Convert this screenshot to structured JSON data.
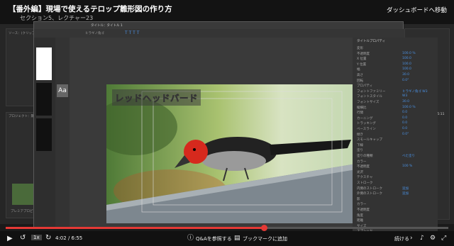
{
  "header": {
    "title": "【番外編】現場で使えるテロップ雛形図の作り方",
    "subtitle": "セクション5、レクチャー23",
    "dashboard_link": "ダッシュボードへ移動"
  },
  "titler": {
    "tab_title": "タイトル：タイトル 1",
    "font_name": "ヒラギノ角ゴ",
    "canvas_text": "レッドヘッドバード",
    "side_label": "Aa",
    "props_title": "タイトルプロパティ",
    "props": [
      {
        "name": "変形",
        "value": ""
      },
      {
        "name": "不透明度",
        "value": "100.0 %"
      },
      {
        "name": "X 位置",
        "value": "100.0"
      },
      {
        "name": "Y 位置",
        "value": "100.0"
      },
      {
        "name": "幅",
        "value": "100.0"
      },
      {
        "name": "高さ",
        "value": "30.0"
      },
      {
        "name": "回転",
        "value": "0.0°"
      },
      {
        "name": "プロパティ",
        "value": ""
      },
      {
        "name": "フォントファミリー",
        "value": "ヒラギノ角ゴ W3"
      },
      {
        "name": "フォントスタイル",
        "value": "W3"
      },
      {
        "name": "フォントサイズ",
        "value": "30.0"
      },
      {
        "name": "縦横比",
        "value": "100.0 %"
      },
      {
        "name": "行間",
        "value": "0.0"
      },
      {
        "name": "カーニング",
        "value": "0.0"
      },
      {
        "name": "トラッキング",
        "value": "0.0"
      },
      {
        "name": "ベースライン",
        "value": "0.0"
      },
      {
        "name": "傾き",
        "value": "0.0°"
      },
      {
        "name": "スモールキャップ",
        "value": ""
      },
      {
        "name": "下線",
        "value": ""
      },
      {
        "name": "塗り",
        "value": ""
      },
      {
        "name": "塗りの種類",
        "value": "べた塗り"
      },
      {
        "name": "カラー",
        "value": ""
      },
      {
        "name": "不透明度",
        "value": "100 %"
      },
      {
        "name": "光沢",
        "value": ""
      },
      {
        "name": "テクスチャ",
        "value": ""
      },
      {
        "name": "ストローク",
        "value": ""
      },
      {
        "name": "内側のストローク",
        "value": "追加"
      },
      {
        "name": "外側のストローク",
        "value": "追加"
      },
      {
        "name": "影",
        "value": ""
      },
      {
        "name": "カラー",
        "value": ""
      },
      {
        "name": "不透明度",
        "value": ""
      },
      {
        "name": "角度",
        "value": ""
      },
      {
        "name": "距離",
        "value": ""
      },
      {
        "name": "サイズ",
        "value": ""
      },
      {
        "name": "スプレッド",
        "value": ""
      },
      {
        "name": "背景",
        "value": ""
      }
    ]
  },
  "workspace": {
    "project_label": "プロジェクト：無題",
    "timecode": "00:00:15:11",
    "left_tab": "ソース：(クリップなし)",
    "clip_label": "プレミアプロピー"
  },
  "player": {
    "time": "4:02 / 6:55",
    "progress": 0.583,
    "speed": "1x",
    "qa_label": "Q&Aを参照する",
    "bookmark_label": "ブックマークに追加",
    "continue_label": "続ける"
  },
  "colors": {
    "accent": "#e53935",
    "link": "#4a90e2"
  }
}
